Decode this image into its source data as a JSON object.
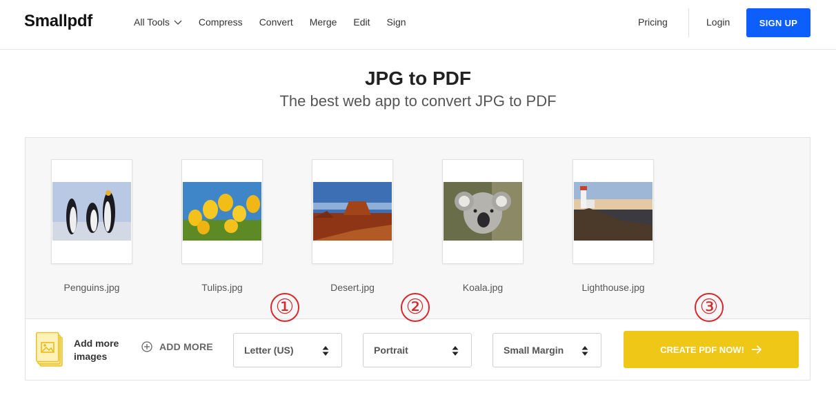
{
  "header": {
    "logo": "Smallpdf",
    "nav": [
      "All Tools",
      "Compress",
      "Convert",
      "Merge",
      "Edit",
      "Sign"
    ],
    "pricing": "Pricing",
    "login": "Login",
    "signup": "SIGN UP",
    "accent_color": "#0c5ffb"
  },
  "page": {
    "title": "JPG to PDF",
    "subtitle": "The best web app to convert JPG to PDF"
  },
  "files": [
    {
      "name": "Penguins.jpg",
      "icon": "penguins-image"
    },
    {
      "name": "Tulips.jpg",
      "icon": "tulips-image"
    },
    {
      "name": "Desert.jpg",
      "icon": "desert-image"
    },
    {
      "name": "Koala.jpg",
      "icon": "koala-image"
    },
    {
      "name": "Lighthouse.jpg",
      "icon": "lighthouse-image"
    }
  ],
  "toolbar": {
    "add_images_label": "Add more images",
    "add_more_button": "ADD MORE",
    "page_size": "Letter (US)",
    "orientation": "Portrait",
    "margin": "Small Margin",
    "create_button": "CREATE PDF NOW!",
    "create_color": "#efc817"
  },
  "annotations": [
    "①",
    "②",
    "③"
  ],
  "annotation_color": "#d8262b"
}
